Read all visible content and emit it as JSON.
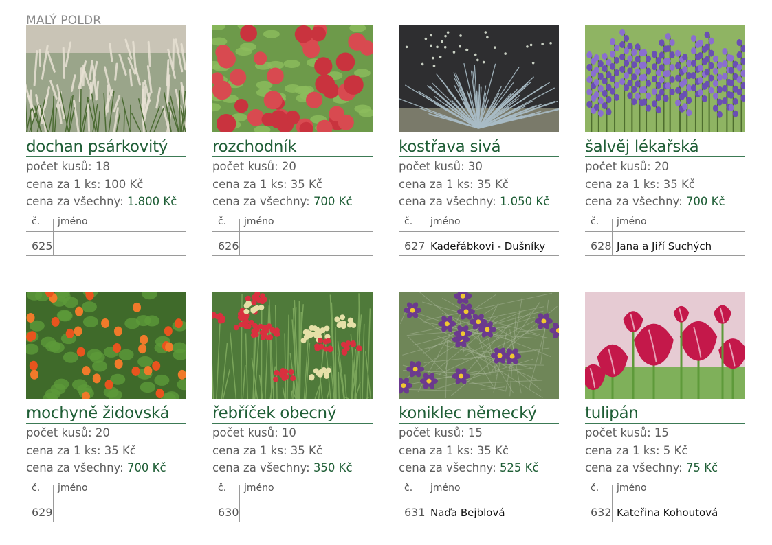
{
  "header": {
    "title": "MALÝ POLDR"
  },
  "labels": {
    "count": "počet kusů:",
    "unit_price": "cena za 1 ks:",
    "total_price": "cena za všechny:",
    "col_num": "č.",
    "col_name": "jméno"
  },
  "plants": [
    {
      "name": "dochan psárkovitý",
      "count": "18",
      "unit_price": "100 Kč",
      "total_price": "1.800 Kč",
      "number": "625",
      "reserved_by": "",
      "photo_icon": "ornamental-grass-photo"
    },
    {
      "name": "rozchodník",
      "count": "20",
      "unit_price": "35 Kč",
      "total_price": "700 Kč",
      "number": "626",
      "reserved_by": "",
      "photo_icon": "red-sedum-photo"
    },
    {
      "name": "kostřava sivá",
      "count": "30",
      "unit_price": "35 Kč",
      "total_price": "1.050 Kč",
      "number": "627",
      "reserved_by": "Kadeřábkovi - Dušníky",
      "photo_icon": "blue-fescue-photo"
    },
    {
      "name": "šalvěj lékařská",
      "count": "20",
      "unit_price": "35 Kč",
      "total_price": "700 Kč",
      "number": "628",
      "reserved_by": "Jana a Jiří Suchých",
      "photo_icon": "purple-salvia-photo"
    },
    {
      "name": "mochyně židovská",
      "count": "20",
      "unit_price": "35 Kč",
      "total_price": "700 Kč",
      "number": "629",
      "reserved_by": "",
      "photo_icon": "physalis-lantern-photo"
    },
    {
      "name": "řebříček obecný",
      "count": "10",
      "unit_price": "35 Kč",
      "total_price": "350 Kč",
      "number": "630",
      "reserved_by": "",
      "photo_icon": "red-yarrow-photo"
    },
    {
      "name": "koniklec německý",
      "count": "15",
      "unit_price": "35 Kč",
      "total_price": "525 Kč",
      "number": "631",
      "reserved_by": "Naďa Bejblová",
      "photo_icon": "pasqueflower-photo"
    },
    {
      "name": "tulipán",
      "count": "15",
      "unit_price": "5 Kč",
      "total_price": "75 Kč",
      "number": "632",
      "reserved_by": "Kateřina Kohoutová",
      "photo_icon": "pink-tulip-photo"
    }
  ],
  "colors": {
    "title_green": "#1f5e36",
    "rule_green": "#3c7a55",
    "text_gray": "#5e5e5e"
  }
}
